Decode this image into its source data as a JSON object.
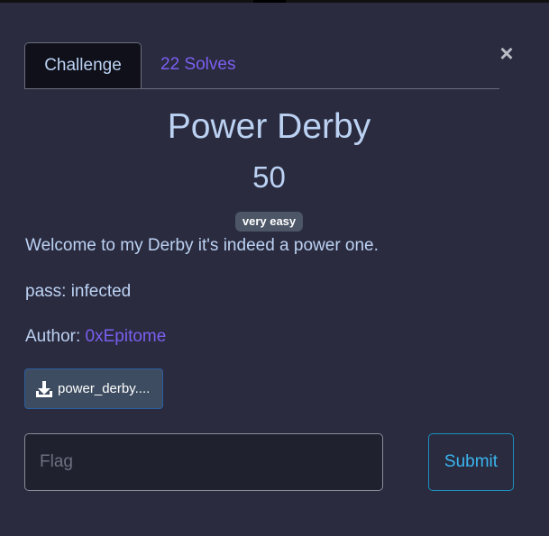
{
  "tabs": {
    "challenge_label": "Challenge",
    "solves_label": "22 Solves"
  },
  "close_label": "×",
  "challenge": {
    "name": "Power Derby",
    "points": "50",
    "difficulty": "very easy",
    "description_line1": "Welcome to my Derby it's indeed a power one.",
    "description_line2": "pass: infected",
    "author_prefix": "Author: ",
    "author_name": "0xEpitome"
  },
  "file": {
    "label": "power_derby....",
    "icon": "download-icon"
  },
  "form": {
    "flag_placeholder": "Flag",
    "flag_value": "",
    "submit_label": "Submit"
  },
  "colors": {
    "background": "#2a2b3f",
    "text": "#bcd2f3",
    "accent_link": "#7b5ff2",
    "submit_accent": "#3ab6ef",
    "badge": "#4c5666"
  }
}
